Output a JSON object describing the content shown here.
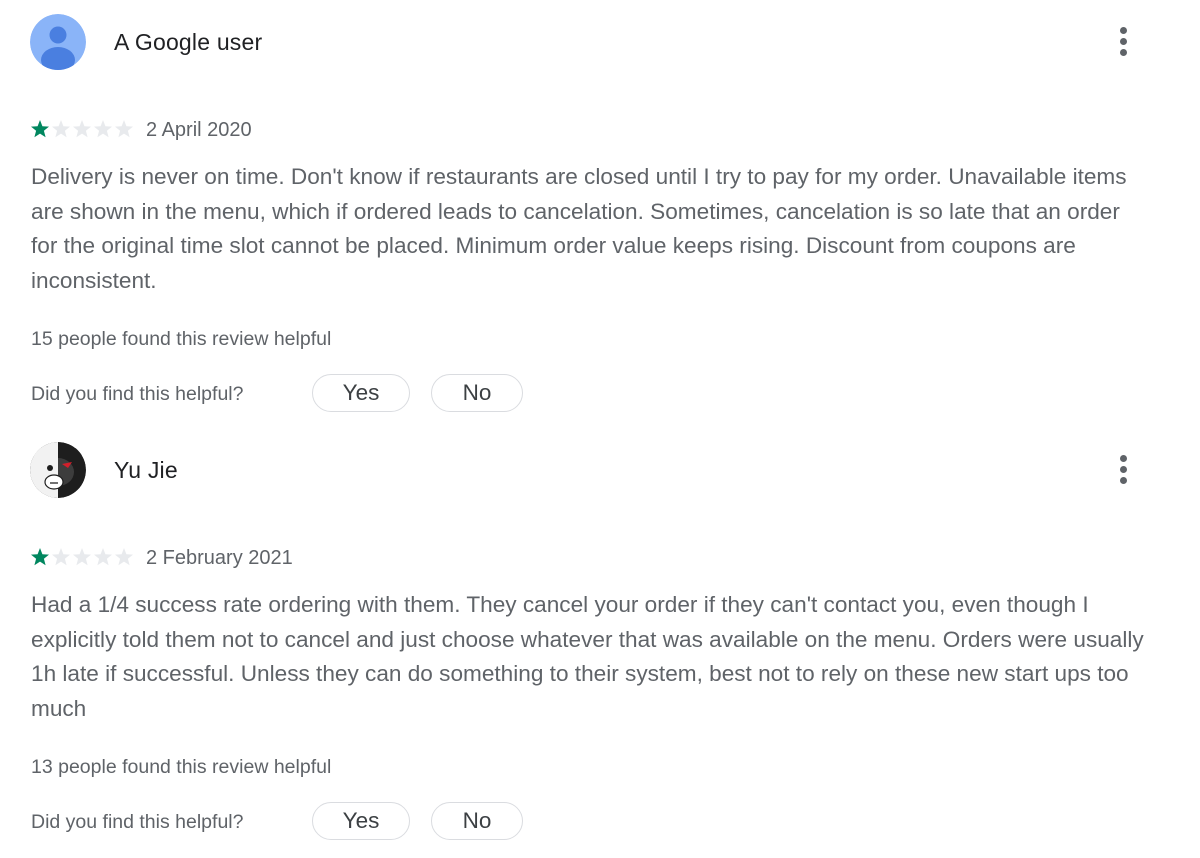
{
  "reviews": [
    {
      "author": "A Google user",
      "avatar": "default-person-avatar",
      "rating": 1,
      "rating_max": 5,
      "date": "2 April 2020",
      "text": "Delivery is never on time. Don't know if restaurants are closed until I try to pay for my order. Unavailable items are shown in the menu, which if ordered leads to cancelation. Sometimes, cancelation is so late that an order for the original time slot cannot be placed. Minimum order value keeps rising. Discount from coupons are inconsistent.",
      "helpful_count_text": "15 people found this review helpful",
      "helpful_question": "Did you find this helpful?",
      "yes_label": "Yes",
      "no_label": "No"
    },
    {
      "author": "Yu Jie",
      "avatar": "monokuma-avatar",
      "rating": 1,
      "rating_max": 5,
      "date": "2 February 2021",
      "text": "Had a 1/4 success rate ordering with them. They cancel your order if they can't contact you, even though I explicitly told them not to cancel and just choose whatever that was available on the menu. Orders were usually 1h late if successful. Unless they can do something to their system, best not to rely on these new start ups too much",
      "helpful_count_text": "13 people found this review helpful",
      "helpful_question": "Did you find this helpful?",
      "yes_label": "Yes",
      "no_label": "No"
    }
  ],
  "colors": {
    "star_filled": "#01875f",
    "star_empty": "#e8eaed",
    "avatar_bg": "#8ab4f8",
    "avatar_figure": "#4a7fe0",
    "text_secondary": "#5f6368",
    "pill_border": "#dadce0"
  },
  "icons": {
    "more": "more-vert-icon",
    "star": "star-icon"
  }
}
